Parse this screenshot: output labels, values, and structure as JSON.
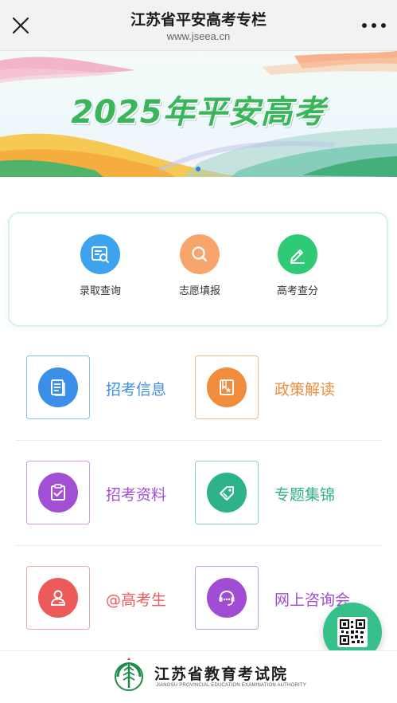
{
  "nav": {
    "title": "江苏省平安高考专栏",
    "url": "www.jseea.cn",
    "close_icon": "close-icon",
    "more_icon": "more-dots-icon"
  },
  "banner": {
    "title": "2025年平安高考",
    "carousel_index": 1,
    "carousel_total": 1
  },
  "query": {
    "items": [
      {
        "label": "录取查询",
        "icon": "admission-search-icon",
        "color": "#3ea3ee"
      },
      {
        "label": "志愿填报",
        "icon": "search-icon",
        "color": "#f7a56c"
      },
      {
        "label": "高考查分",
        "icon": "pencil-icon",
        "color": "#2fca76"
      }
    ]
  },
  "menu": {
    "items": [
      {
        "label": "招考信息",
        "icon": "document-icon",
        "color": "#3b8fe8",
        "border": "#8cc0f3"
      },
      {
        "label": "政策解读",
        "icon": "bookmark-star-icon",
        "color": "#f08d3c",
        "border": "#f5b88a"
      },
      {
        "label": "招考资料",
        "icon": "clipboard-check-icon",
        "color": "#a24fd6",
        "border": "#cc9fe6"
      },
      {
        "label": "专题集锦",
        "icon": "tag-icon",
        "color": "#2db28a",
        "border": "#84d4bb"
      },
      {
        "label": "@高考生",
        "icon": "user-icon",
        "color": "#ec5a5a",
        "border": "#f2a7a7"
      },
      {
        "label": "网上咨询会",
        "icon": "chat-icon",
        "color": "#a04cd4",
        "border": "#c99be4"
      }
    ]
  },
  "qr": {
    "icon": "qr-code-icon",
    "color": "#36c08c"
  },
  "footer": {
    "name": "江苏省教育考试院",
    "name_en": "JIANGSU PROVINCIAL EDUCATION EXAMINATION AUTHORITY"
  }
}
